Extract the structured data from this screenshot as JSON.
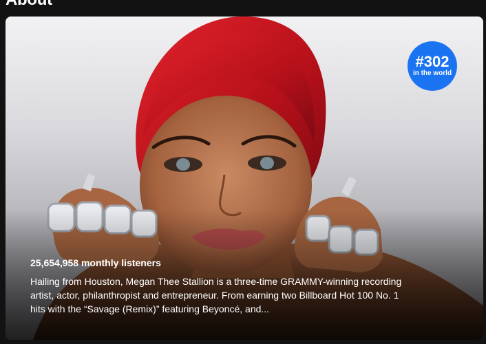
{
  "section": {
    "title": "About"
  },
  "about": {
    "image_alt": "Megan Thee Stallion",
    "rank": {
      "number": "#302",
      "caption": "in the world"
    },
    "monthly_listeners": "25,654,958 monthly listeners",
    "bio": "Hailing from Houston, Megan Thee Stallion is a three-time GRAMMY-winning recording artist, actor, philanthropist and entrepreneur. From earning two Billboard Hot 100 No. 1 hits with the “Savage (Remix)” featuring Beyoncé, and..."
  },
  "colors": {
    "background": "#121212",
    "badge": "#1a73f0",
    "hair": "#c8141e",
    "skin": "#b0704e"
  }
}
